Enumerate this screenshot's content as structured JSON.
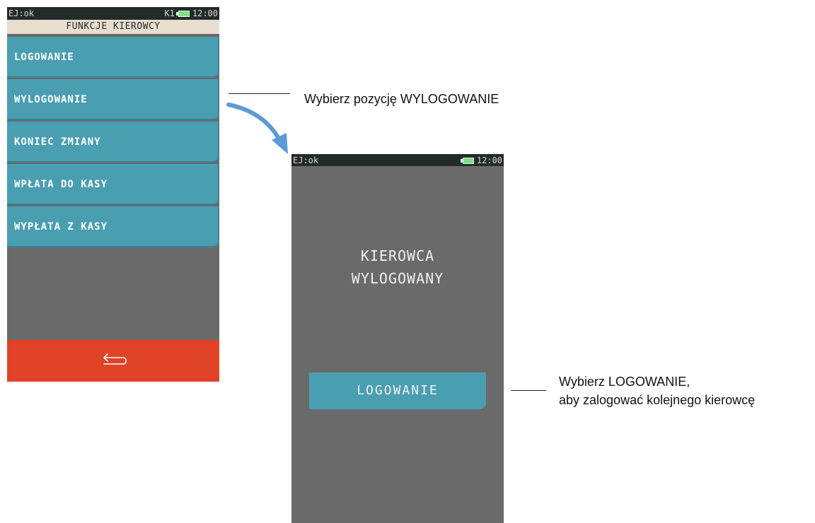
{
  "screen1": {
    "status": {
      "left": "EJ:ok",
      "right_prefix": "K1",
      "time": "12:00"
    },
    "title": "FUNKCJE KIEROWCY",
    "menu": [
      {
        "label": "LOGOWANIE"
      },
      {
        "label": "WYLOGOWANIE"
      },
      {
        "label": "KONIEC ZMIANY"
      },
      {
        "label": "WPŁATA DO KASY"
      },
      {
        "label": "WYPŁATA Z KASY"
      }
    ],
    "back_icon": "return-arrow-icon"
  },
  "screen2": {
    "status": {
      "left": "EJ:ok",
      "time": "12:00"
    },
    "message_line1": "KIEROWCA",
    "message_line2": "WYLOGOWANY",
    "button": "LOGOWANIE"
  },
  "annotations": {
    "caption1": "Wybierz pozycję WYLOGOWANIE",
    "caption2_line1": "Wybierz LOGOWANIE,",
    "caption2_line2": "aby zalogować kolejnego kierowcę"
  },
  "colors": {
    "menu_item": "#4a9eb1",
    "screen_bg": "#6b6a6a",
    "back_bar": "#e04327",
    "status_bar": "#232b2a",
    "title_bar": "#e7ded0",
    "arrow": "#5b9bd5"
  }
}
